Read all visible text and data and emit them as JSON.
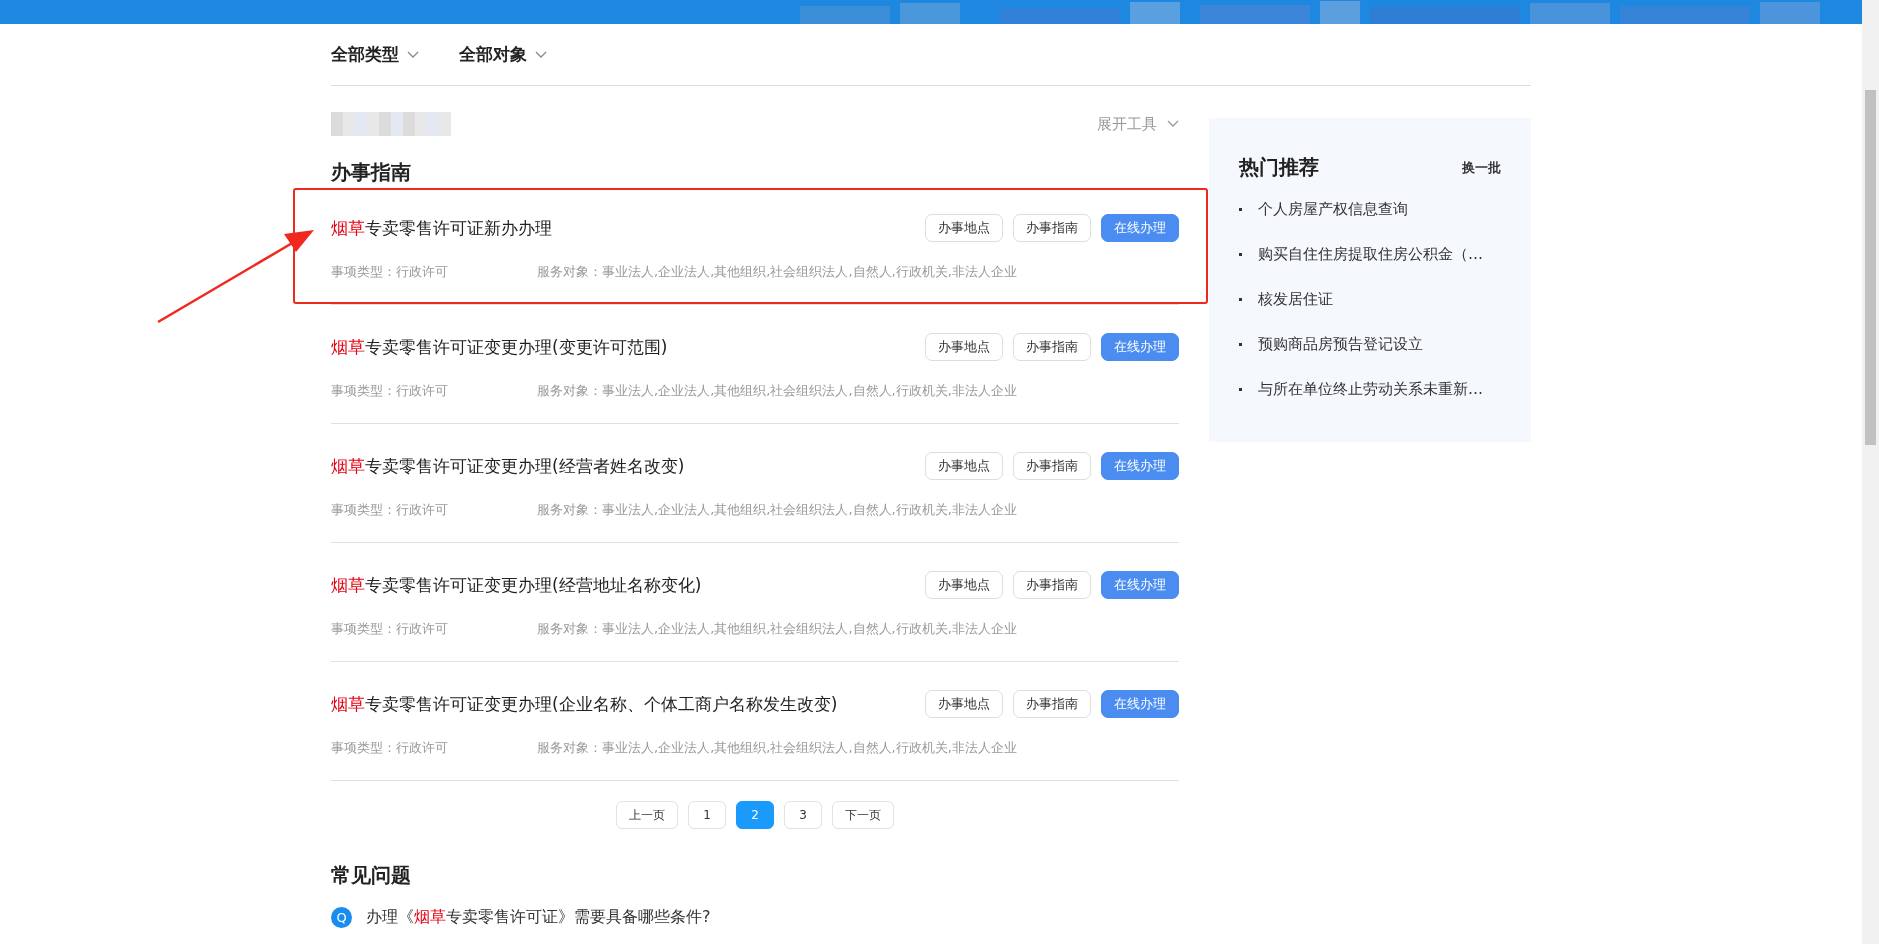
{
  "filters": [
    {
      "label": "全部类型"
    },
    {
      "label": "全部对象"
    }
  ],
  "tools_toggle": {
    "label": "展开工具"
  },
  "guide": {
    "heading": "办事指南",
    "items": [
      {
        "keyword": "烟草",
        "rest": "专卖零售许可证新办办理",
        "type": "事项类型：行政许可",
        "audience": "服务对象：事业法人,企业法人,其他组织,社会组织法人,自然人,行政机关,非法人企业",
        "outlined": true,
        "buttons": [
          {
            "label": "办事地点",
            "kind": "plain"
          },
          {
            "label": "办事指南",
            "kind": "plain"
          },
          {
            "label": "在线办理",
            "kind": "primary"
          }
        ]
      },
      {
        "keyword": "烟草",
        "rest": "专卖零售许可证变更办理(变更许可范围)",
        "type": "事项类型：行政许可",
        "audience": "服务对象：事业法人,企业法人,其他组织,社会组织法人,自然人,行政机关,非法人企业",
        "outlined": false,
        "buttons": [
          {
            "label": "办事地点",
            "kind": "plain"
          },
          {
            "label": "办事指南",
            "kind": "plain"
          },
          {
            "label": "在线办理",
            "kind": "primary"
          }
        ]
      },
      {
        "keyword": "烟草",
        "rest": "专卖零售许可证变更办理(经营者姓名改变)",
        "type": "事项类型：行政许可",
        "audience": "服务对象：事业法人,企业法人,其他组织,社会组织法人,自然人,行政机关,非法人企业",
        "outlined": false,
        "buttons": [
          {
            "label": "办事地点",
            "kind": "plain"
          },
          {
            "label": "办事指南",
            "kind": "plain"
          },
          {
            "label": "在线办理",
            "kind": "primary"
          }
        ]
      },
      {
        "keyword": "烟草",
        "rest": "专卖零售许可证变更办理(经营地址名称变化)",
        "type": "事项类型：行政许可",
        "audience": "服务对象：事业法人,企业法人,其他组织,社会组织法人,自然人,行政机关,非法人企业",
        "outlined": false,
        "buttons": [
          {
            "label": "办事地点",
            "kind": "plain"
          },
          {
            "label": "办事指南",
            "kind": "plain"
          },
          {
            "label": "在线办理",
            "kind": "primary"
          }
        ]
      },
      {
        "keyword": "烟草",
        "rest": "专卖零售许可证变更办理(企业名称、个体工商户名称发生改变)",
        "type": "事项类型：行政许可",
        "audience": "服务对象：事业法人,企业法人,其他组织,社会组织法人,自然人,行政机关,非法人企业",
        "outlined": false,
        "buttons": [
          {
            "label": "办事地点",
            "kind": "plain"
          },
          {
            "label": "办事指南",
            "kind": "plain"
          },
          {
            "label": "在线办理",
            "kind": "primary"
          }
        ]
      }
    ]
  },
  "pagination": [
    {
      "label": "上一页",
      "selected": false
    },
    {
      "label": "1",
      "selected": false
    },
    {
      "label": "2",
      "selected": true
    },
    {
      "label": "3",
      "selected": false
    },
    {
      "label": "下一页",
      "selected": false
    }
  ],
  "faq": {
    "heading": "常见问题",
    "items": [
      {
        "icon_letter": "Q",
        "before": "办理《",
        "keyword": "烟草",
        "after": "专卖零售许可证》需要具备哪些条件?"
      }
    ]
  },
  "sidebar": {
    "title": "热门推荐",
    "refresh": "换一批",
    "items": [
      "个人房屋产权信息查询",
      "购买自住住房提取住房公积金（…",
      "核发居住证",
      "预购商品房预告登记设立",
      "与所在单位终止劳动关系未重新…"
    ]
  }
}
